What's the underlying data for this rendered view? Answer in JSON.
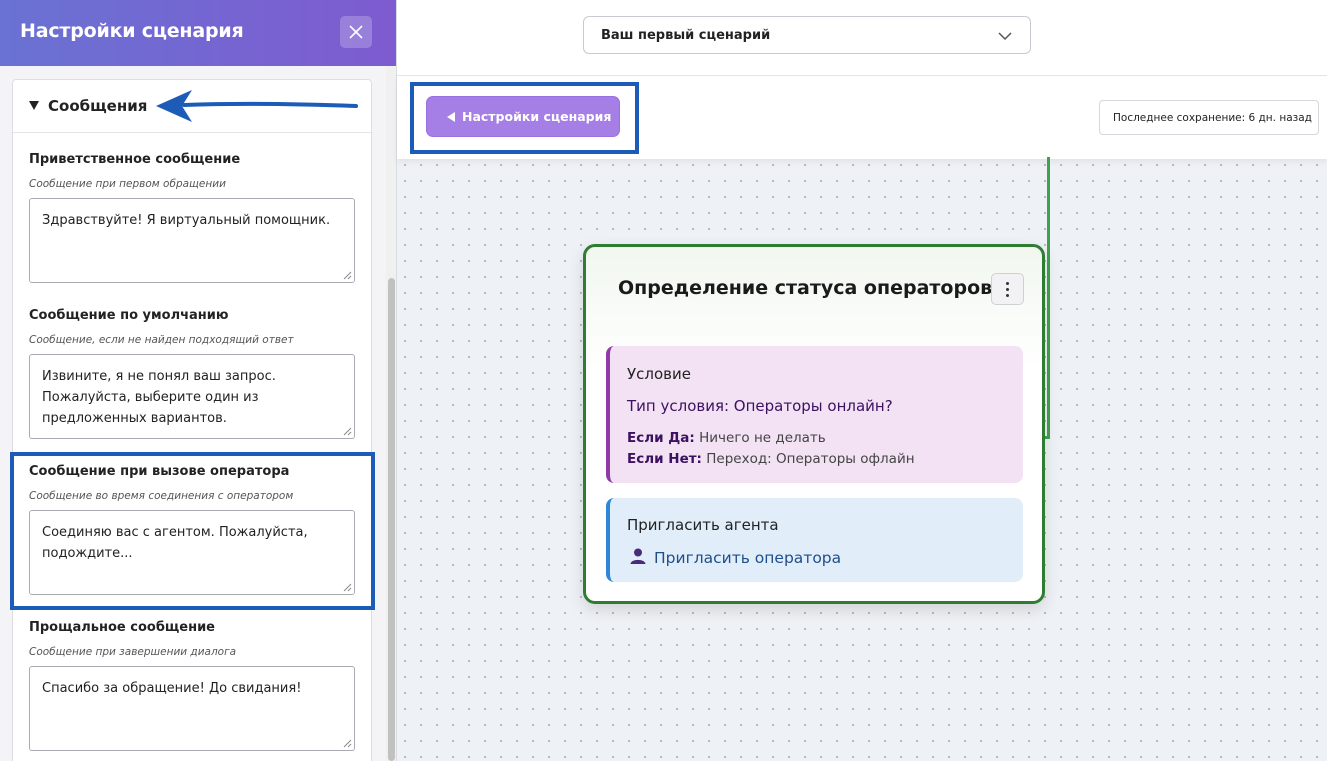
{
  "sidebar": {
    "title": "Настройки сценария",
    "close_icon": "close-icon",
    "section": {
      "title": "Сообщения",
      "expanded": true
    },
    "fields": [
      {
        "label": "Приветственное сообщение",
        "hint": "Сообщение при первом обращении",
        "value": "Здравствуйте! Я виртуальный помощник."
      },
      {
        "label": "Сообщение по умолчанию",
        "hint": "Сообщение, если не найден подходящий ответ",
        "value": "Извините, я не понял ваш запрос. Пожалуйста, выберите один из предложенных вариантов."
      },
      {
        "label": "Сообщение при вызове оператора",
        "hint": "Сообщение во время соединения с оператором",
        "value": "Соединяю вас с агентом. Пожалуйста, подождите..."
      },
      {
        "label": "Прощальное сообщение",
        "hint": "Сообщение при завершении диалога",
        "value": "Спасибо за обращение! До свидания!"
      }
    ]
  },
  "header": {
    "scenario_select": "Ваш первый сценарий"
  },
  "toolbar": {
    "settings_button": "Настройки сценария",
    "last_saved": "Последнее сохранение: 6 дн. назад"
  },
  "node": {
    "title": "Определение статуса операторов",
    "condition": {
      "heading": "Условие",
      "type": "Тип условия: Операторы онлайн?",
      "yes_label": "Если Да:",
      "yes_value": "Ничего не делать",
      "no_label": "Если Нет:",
      "no_value": "Переход: Операторы офлайн"
    },
    "invite": {
      "heading": "Пригласить агента",
      "link": "Пригласить оператора",
      "icon": "user-icon"
    }
  },
  "colors": {
    "header_gradient_start": "#6a72d3",
    "header_gradient_end": "#7e5bd0",
    "settings_button": "#a57ee6",
    "highlight_frame": "#1c5bb8",
    "node_border": "#2f7d32",
    "condition_accent": "#8f3aa6",
    "invite_accent": "#2f86d6"
  }
}
